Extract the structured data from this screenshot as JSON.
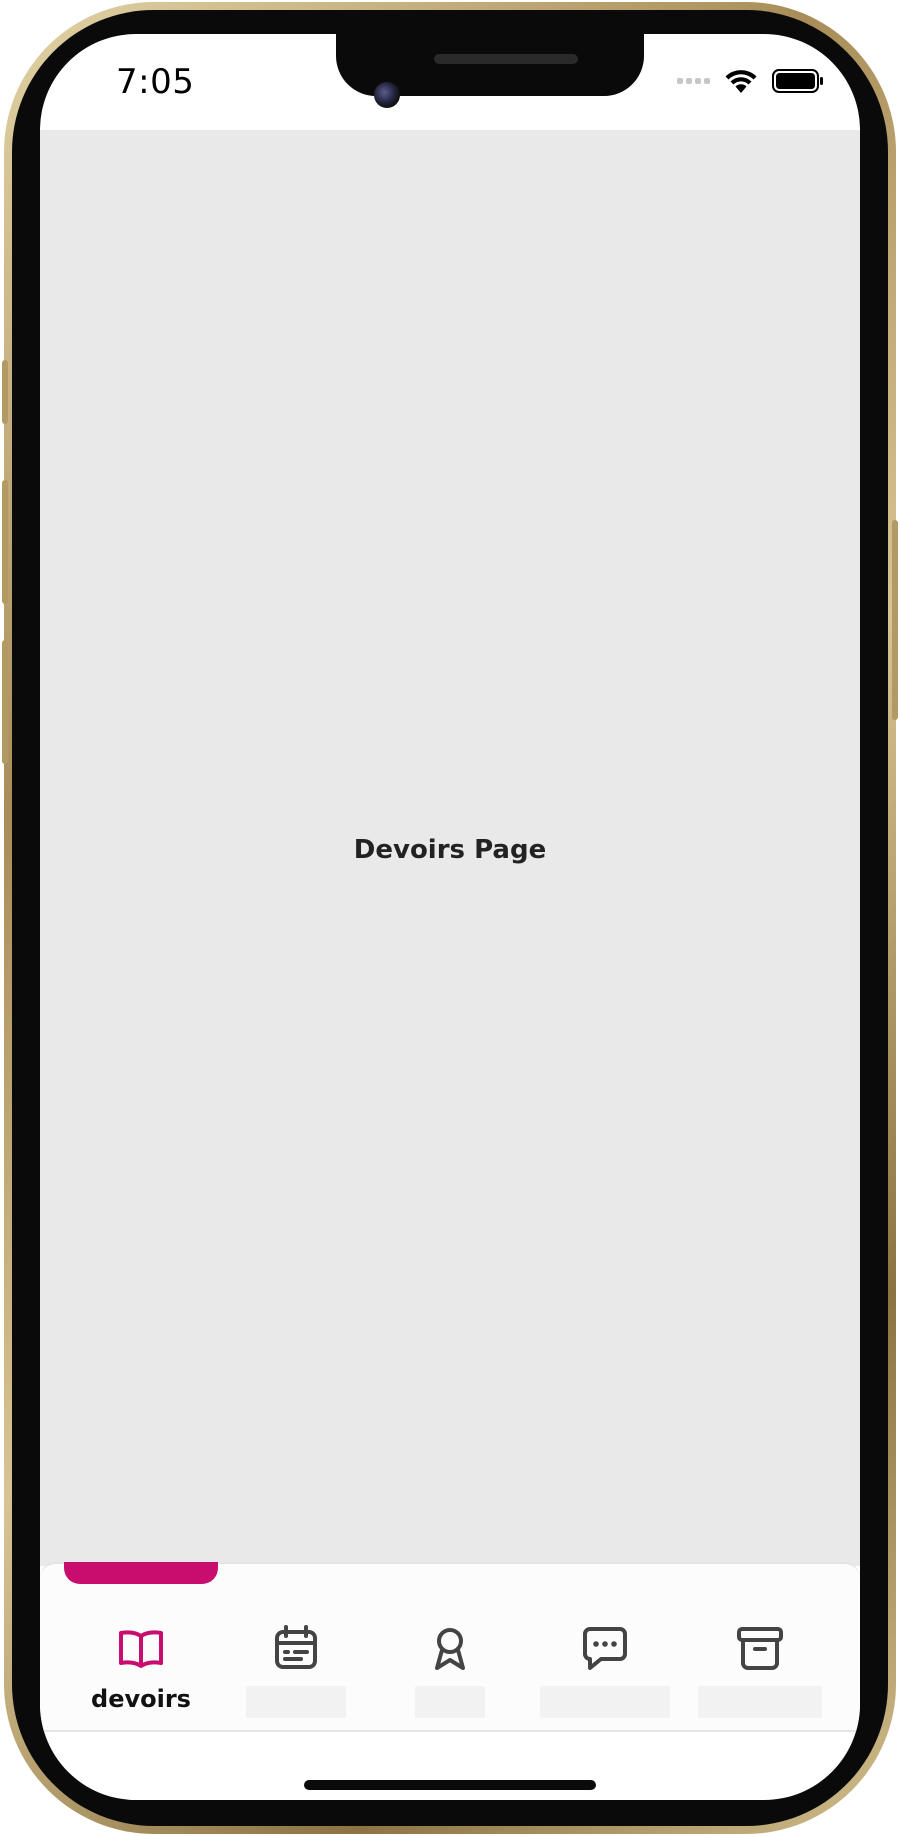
{
  "status_bar": {
    "time": "7:05"
  },
  "main": {
    "title": "Devoirs Page"
  },
  "tab_bar": {
    "active_index": 0,
    "accent_color": "#c80d6e",
    "tabs": [
      {
        "icon": "open-book-icon",
        "label": "devoirs"
      },
      {
        "icon": "calendar-icon",
        "label": ""
      },
      {
        "icon": "award-ribbon-icon",
        "label": ""
      },
      {
        "icon": "chat-bubble-icon",
        "label": ""
      },
      {
        "icon": "archive-box-icon",
        "label": ""
      }
    ]
  }
}
